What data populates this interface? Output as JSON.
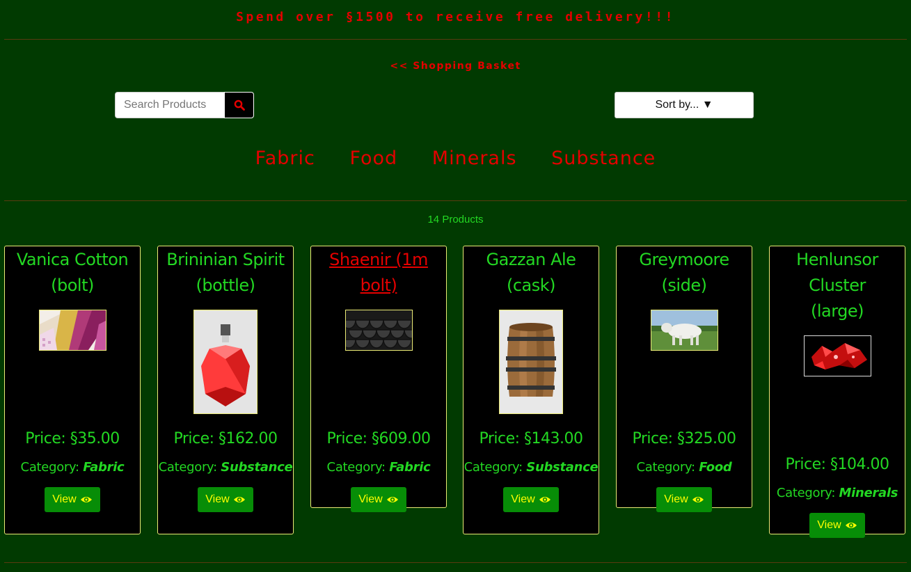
{
  "banner": {
    "text": "Spend over §1500 to receive free delivery!!!"
  },
  "basket_link": {
    "label": "<< Shopping Basket"
  },
  "search": {
    "placeholder": "Search Products"
  },
  "sort": {
    "label": "Sort by... ▼"
  },
  "categories": [
    "Fabric",
    "Food",
    "Minerals",
    "Substance"
  ],
  "product_count": "14 Products",
  "category_prefix": "Category:",
  "view_label": "View",
  "products": [
    {
      "title_line1": "Vanica Cotton",
      "title_line2": "(bolt)",
      "price": "Price: §35.00",
      "category": "Fabric",
      "image": "fabric-swatches"
    },
    {
      "title_line1": "Brininian Spirit",
      "title_line2": "(bottle)",
      "price": "Price: §162.00",
      "category": "Substance",
      "image": "red-spirit-bottle"
    },
    {
      "title_line1": "Shaenir (1m bolt)",
      "title_line2": "",
      "price": "Price: §609.00",
      "category": "Fabric",
      "image": "dark-scales"
    },
    {
      "title_line1": "Gazzan Ale",
      "title_line2": "(cask)",
      "price": "Price: §143.00",
      "category": "Substance",
      "image": "wooden-barrel"
    },
    {
      "title_line1": "Greymoore (side)",
      "title_line2": "",
      "price": "Price: §325.00",
      "category": "Food",
      "image": "white-ox"
    },
    {
      "title_line1": "Henlunsor Cluster",
      "title_line2": "(large)",
      "price": "Price: §104.00",
      "category": "Minerals",
      "image": "red-crystals"
    }
  ],
  "colors": {
    "background": "#013a01",
    "accent_red": "#e50000",
    "text_green": "#23d823",
    "button_green": "#078d07",
    "button_text": "#ffff00",
    "card_border": "#ecec76"
  }
}
